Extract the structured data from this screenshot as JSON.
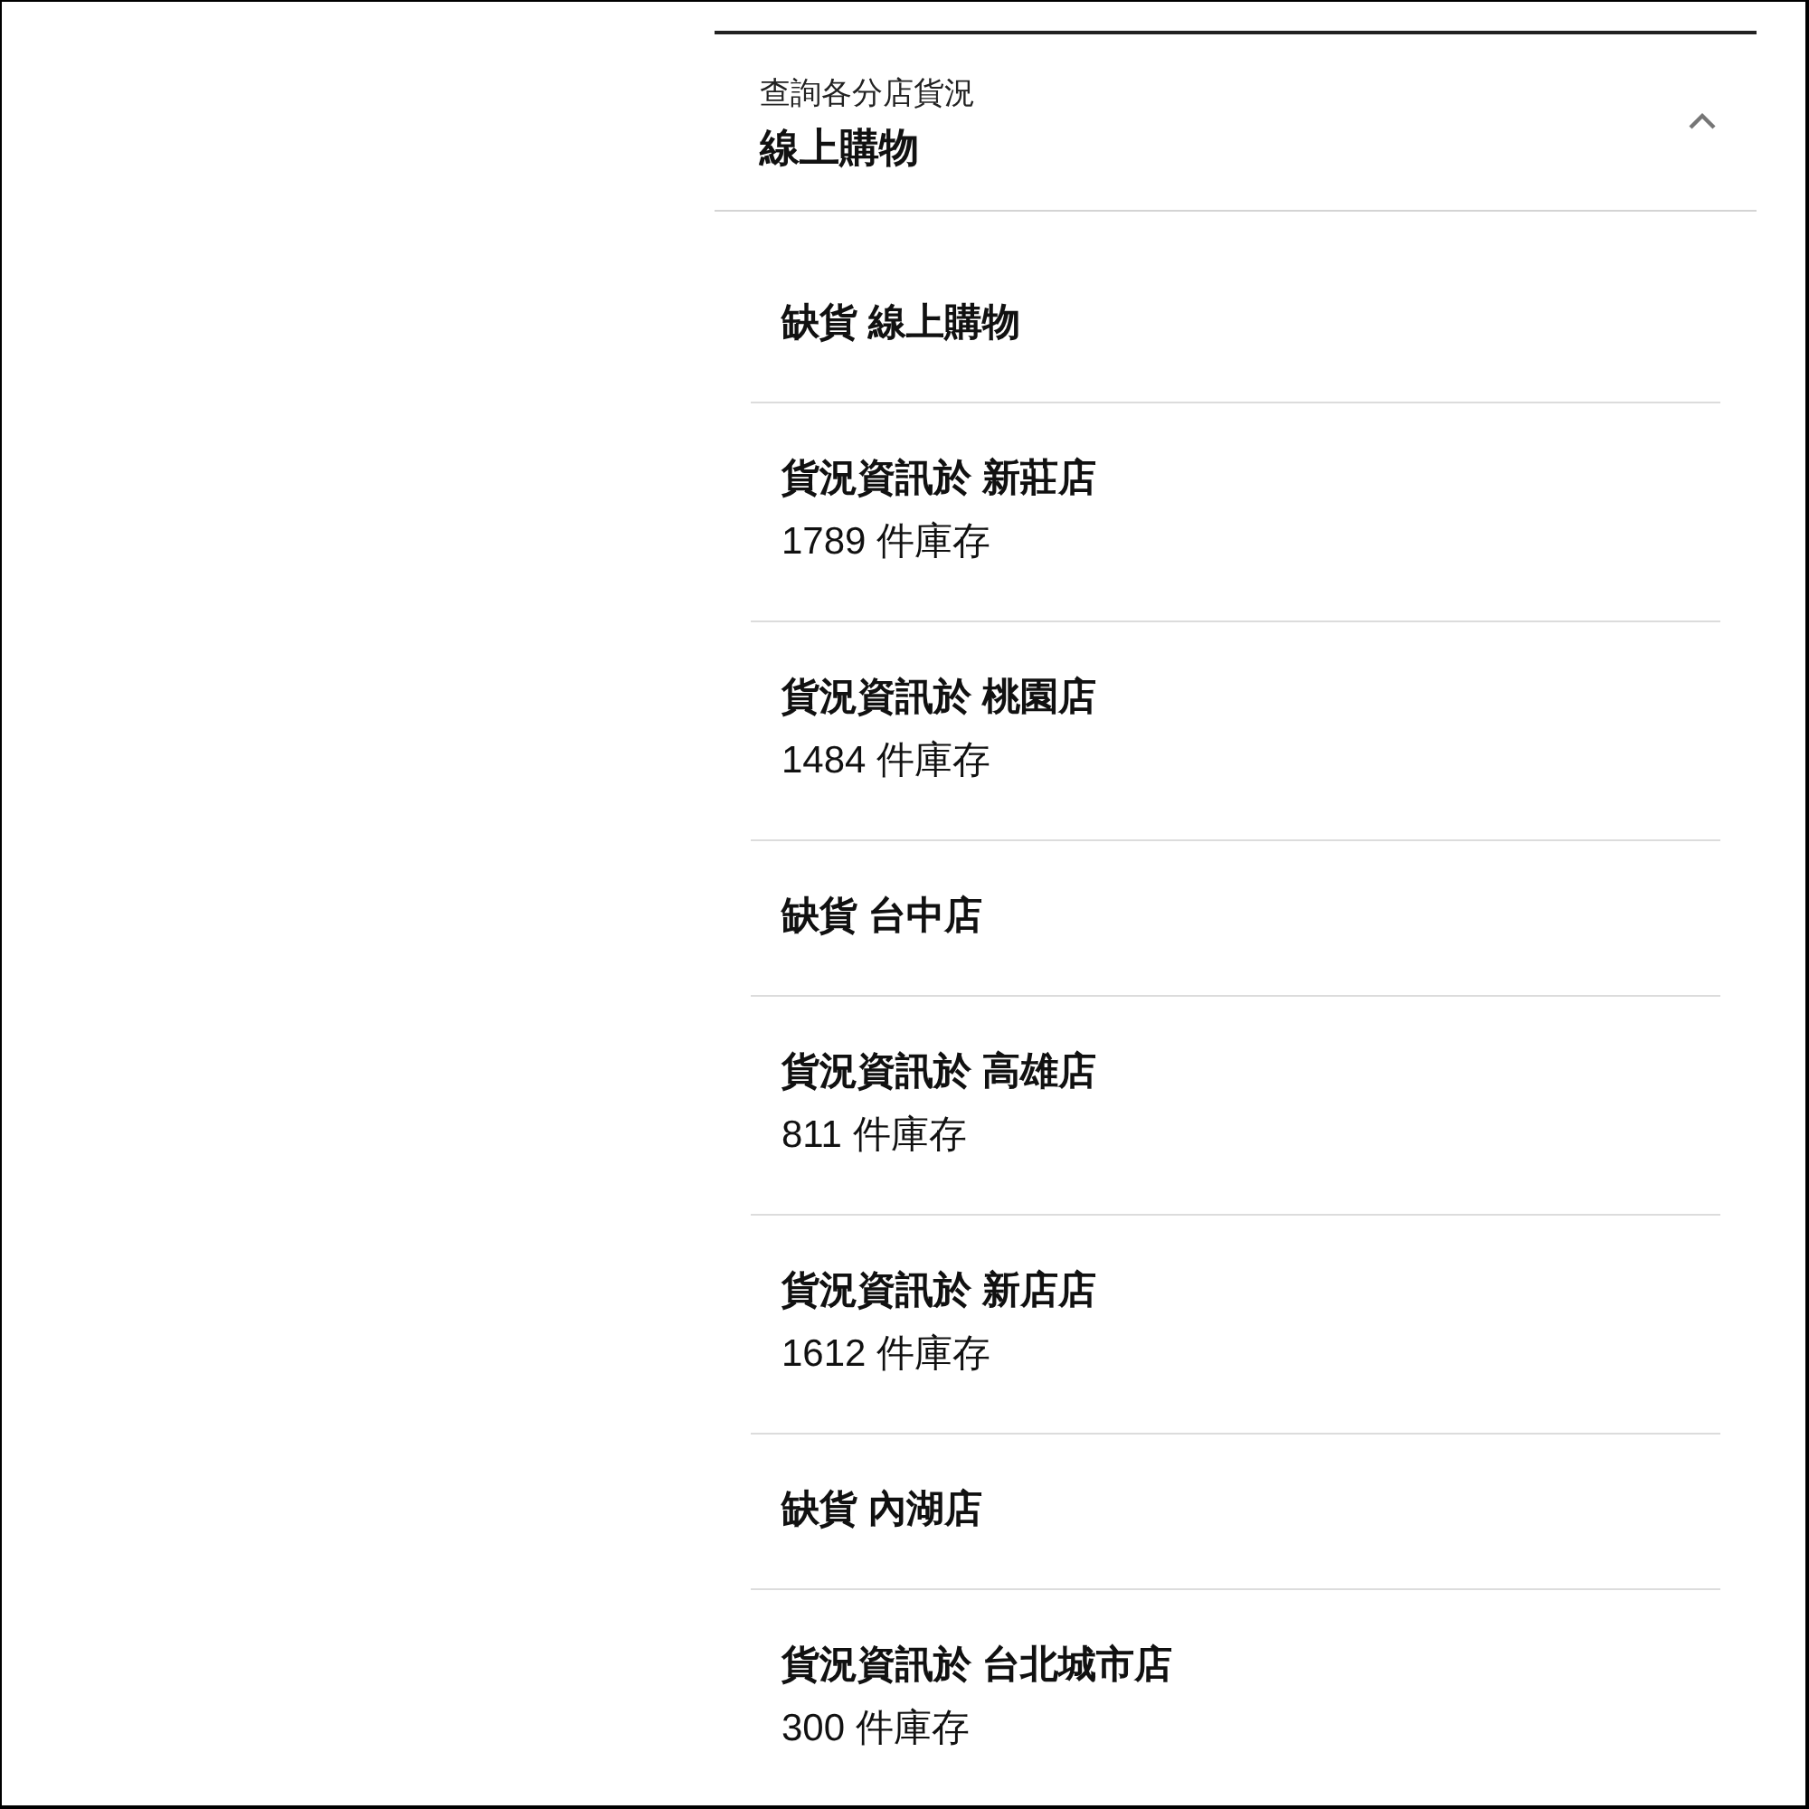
{
  "panel": {
    "subtitle": "查詢各分店貨況",
    "title": "線上購物",
    "expanded": true
  },
  "stores": [
    {
      "heading": "缺貨 線上購物"
    },
    {
      "heading": "貨況資訊於 新莊店",
      "stock": "1789 件庫存"
    },
    {
      "heading": "貨況資訊於 桃園店",
      "stock": "1484 件庫存"
    },
    {
      "heading": "缺貨 台中店"
    },
    {
      "heading": "貨況資訊於 高雄店",
      "stock": "811 件庫存"
    },
    {
      "heading": "貨況資訊於 新店店",
      "stock": "1612 件庫存"
    },
    {
      "heading": "缺貨 內湖店"
    },
    {
      "heading": "貨況資訊於 台北城市店",
      "stock": "300 件庫存"
    }
  ]
}
